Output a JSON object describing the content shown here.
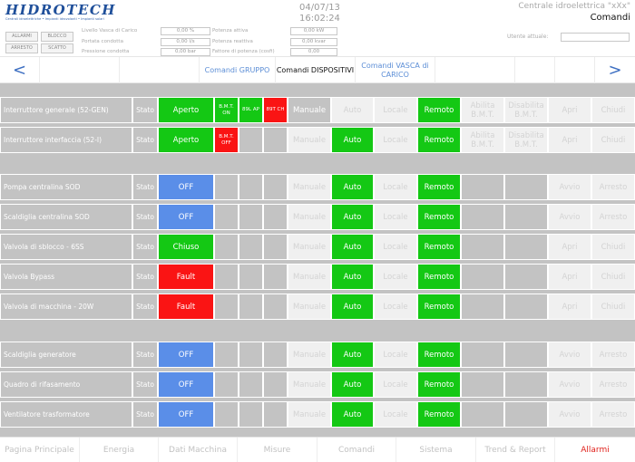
{
  "header": {
    "logo_text": "HIDROTECH",
    "logo_tagline": "Centrali idroelettriche • Impianti idrovolanti • Impianti solari",
    "buttons": [
      "ALLARMI",
      "BLOCCO",
      "ARRESTO",
      "SCATTO"
    ],
    "measures_left": [
      {
        "label": "Livello Vasca di Carico",
        "value": "0,00 %"
      },
      {
        "label": "Portata condotta",
        "value": "0,00 l/s"
      },
      {
        "label": "Pressione condotta",
        "value": "0,00 bar"
      }
    ],
    "measures_right": [
      {
        "label": "Potenza attiva",
        "value": "0,00 kW"
      },
      {
        "label": "Potenza reattiva",
        "value": "0,00 kvar"
      },
      {
        "label": "Fattore di potenza (cosfi)",
        "value": "0,00"
      }
    ],
    "date": "04/07/13",
    "time": "16:02:24",
    "plant": "Centrale idroelettrica \"xXx\"",
    "section": "Comandi",
    "user_label": "Utente attuale:",
    "user_value": ""
  },
  "nav": {
    "prev_arrow": "<",
    "next_arrow": ">",
    "tabs": [
      {
        "label": "Comandi GRUPPO",
        "active": false
      },
      {
        "label": "Comandi DISPOSITIVI",
        "active": true
      },
      {
        "label": "Comandi VASCA di CARICO",
        "active": false
      }
    ]
  },
  "grid": {
    "stato_label": "Stato",
    "rows": [
      {
        "name": "Interruttore generale (52-GEN)",
        "state": {
          "text": "Aperto",
          "color": "green"
        },
        "indicators": [
          {
            "text": "B.M.T. ON",
            "color": "green"
          },
          {
            "text": "89L AP",
            "color": "green"
          },
          {
            "text": "89T CH",
            "color": "red"
          }
        ],
        "manuale": "Manuale",
        "manuale_active": true,
        "auto": "Auto",
        "auto_active": false,
        "locale": "Locale",
        "remoto": "Remoto",
        "extra1": "Abilita B.M.T.",
        "extra2": "Disabilita B.M.T.",
        "cmd1": "Apri",
        "cmd2": "Chiudi"
      },
      {
        "name": "Interruttore interfaccia (52-I)",
        "state": {
          "text": "Aperto",
          "color": "green"
        },
        "indicators": [
          {
            "text": "B.M.T. OFF",
            "color": "red"
          }
        ],
        "manuale": "Manuale",
        "manuale_active": false,
        "auto": "Auto",
        "auto_active": true,
        "locale": "Locale",
        "remoto": "Remoto",
        "extra1": "Abilita B.M.T.",
        "extra2": "Disabilita B.M.T.",
        "cmd1": "Apri",
        "cmd2": "Chiudi"
      },
      {
        "name": "Pompa centralina SOD",
        "state": {
          "text": "OFF",
          "color": "blue"
        },
        "indicators": [],
        "manuale": "Manuale",
        "manuale_active": false,
        "auto": "Auto",
        "auto_active": true,
        "locale": "Locale",
        "remoto": "Remoto",
        "extra1": "",
        "extra2": "",
        "cmd1": "Avvio",
        "cmd2": "Arresto"
      },
      {
        "name": "Scaldiglia centralina SOD",
        "state": {
          "text": "OFF",
          "color": "blue"
        },
        "indicators": [],
        "manuale": "Manuale",
        "manuale_active": false,
        "auto": "Auto",
        "auto_active": true,
        "locale": "Locale",
        "remoto": "Remoto",
        "extra1": "",
        "extra2": "",
        "cmd1": "Avvio",
        "cmd2": "Arresto"
      },
      {
        "name": "Valvola di sblocco - 6SS",
        "state": {
          "text": "Chiuso",
          "color": "green"
        },
        "indicators": [],
        "manuale": "Manuale",
        "manuale_active": false,
        "auto": "Auto",
        "auto_active": true,
        "locale": "Locale",
        "remoto": "Remoto",
        "extra1": "",
        "extra2": "",
        "cmd1": "Apri",
        "cmd2": "Chiudi"
      },
      {
        "name": "Valvola Bypass",
        "state": {
          "text": "Fault",
          "color": "red"
        },
        "indicators": [],
        "manuale": "Manuale",
        "manuale_active": false,
        "auto": "Auto",
        "auto_active": true,
        "locale": "Locale",
        "remoto": "Remoto",
        "extra1": "",
        "extra2": "",
        "cmd1": "Apri",
        "cmd2": "Chiudi"
      },
      {
        "name": "Valvola di macchina - 20W",
        "state": {
          "text": "Fault",
          "color": "red"
        },
        "indicators": [],
        "manuale": "Manuale",
        "manuale_active": false,
        "auto": "Auto",
        "auto_active": true,
        "locale": "Locale",
        "remoto": "Remoto",
        "extra1": "",
        "extra2": "",
        "cmd1": "Apri",
        "cmd2": "Chiudi"
      },
      {
        "name": "Scaldiglia generatore",
        "state": {
          "text": "OFF",
          "color": "blue"
        },
        "indicators": [],
        "manuale": "Manuale",
        "manuale_active": false,
        "auto": "Auto",
        "auto_active": true,
        "locale": "Locale",
        "remoto": "Remoto",
        "extra1": "",
        "extra2": "",
        "cmd1": "Avvio",
        "cmd2": "Arresto"
      },
      {
        "name": "Quadro di rifasamento",
        "state": {
          "text": "OFF",
          "color": "blue"
        },
        "indicators": [],
        "manuale": "Manuale",
        "manuale_active": false,
        "auto": "Auto",
        "auto_active": true,
        "locale": "Locale",
        "remoto": "Remoto",
        "extra1": "",
        "extra2": "",
        "cmd1": "Avvio",
        "cmd2": "Arresto"
      },
      {
        "name": "Ventilatore trasformatore",
        "state": {
          "text": "OFF",
          "color": "blue"
        },
        "indicators": [],
        "manuale": "Manuale",
        "manuale_active": false,
        "auto": "Auto",
        "auto_active": true,
        "locale": "Locale",
        "remoto": "Remoto",
        "extra1": "",
        "extra2": "",
        "cmd1": "Avvio",
        "cmd2": "Arresto"
      }
    ]
  },
  "bottom_nav": [
    {
      "label": "Pagina Principale",
      "alarm": false
    },
    {
      "label": "Energia",
      "alarm": false
    },
    {
      "label": "Dati Macchina",
      "alarm": false
    },
    {
      "label": "Misure",
      "alarm": false
    },
    {
      "label": "Comandi",
      "alarm": false
    },
    {
      "label": "Sistema",
      "alarm": false
    },
    {
      "label": "Trend & Report",
      "alarm": false
    },
    {
      "label": "Allarmi",
      "alarm": true
    }
  ],
  "colors": {
    "green": "#14c814",
    "red": "#fa1414",
    "blue": "#5a8ee8",
    "grid_gray": "#c3c3c3",
    "accent_blue": "#5c8ed6",
    "alarm_red": "#e0201a"
  }
}
